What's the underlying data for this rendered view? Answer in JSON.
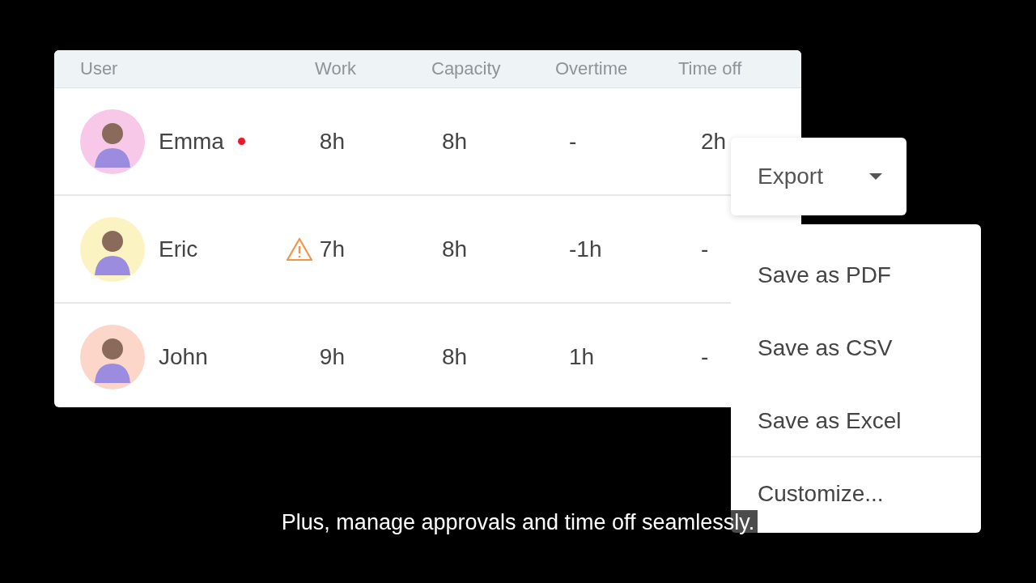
{
  "table": {
    "columns": [
      "User",
      "Work",
      "Capacity",
      "Overtime",
      "Time off"
    ],
    "rows": [
      {
        "name": "Emma",
        "color": "#f7c8e8",
        "status_dot": true,
        "warning": false,
        "work": "8h",
        "capacity": "8h",
        "overtime": "-",
        "time_off": "2h"
      },
      {
        "name": "Eric",
        "color": "#fbf4c2",
        "status_dot": false,
        "warning": true,
        "work": "7h",
        "capacity": "8h",
        "overtime": "-1h",
        "time_off": "-"
      },
      {
        "name": "John",
        "color": "#fbd6c9",
        "status_dot": false,
        "warning": false,
        "work": "9h",
        "capacity": "8h",
        "overtime": "1h",
        "time_off": "-"
      }
    ]
  },
  "export_button": {
    "label": "Export"
  },
  "menu": {
    "items": [
      {
        "label": "Save as PDF",
        "separated": false
      },
      {
        "label": "Save as CSV",
        "separated": false
      },
      {
        "label": "Save as Excel",
        "separated": false
      },
      {
        "label": "Customize...",
        "separated": true
      }
    ]
  },
  "caption": "Plus, manage approvals and time off seamlessly."
}
